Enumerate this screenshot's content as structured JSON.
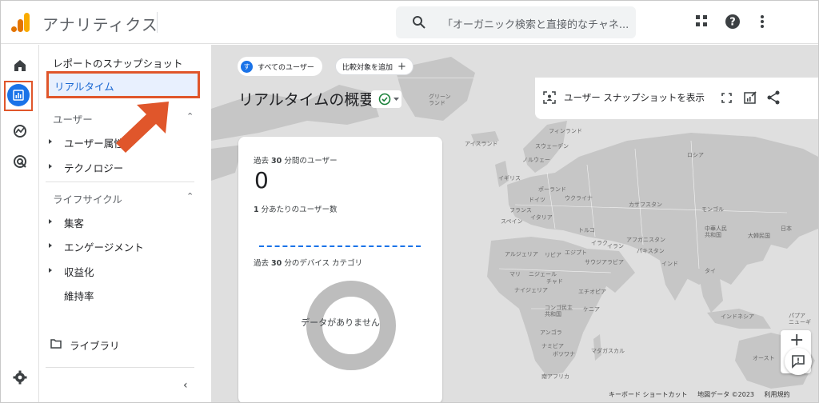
{
  "app": {
    "title": "アナリティクス",
    "logo_icon": "analytics-logo-icon"
  },
  "search": {
    "placeholder": "「オーガニック検索と直接的なチャネ..."
  },
  "topbar_icons": [
    "apps-grid-icon",
    "help-icon",
    "more-vert-icon"
  ],
  "rail": [
    "home-icon",
    "reports-icon",
    "explore-icon",
    "advertising-icon",
    "settings-icon"
  ],
  "nav": {
    "snapshot": "レポートのスナップショット",
    "realtime": "リアルタイム",
    "users_header": "ユーザー",
    "user_attributes": "ユーザー属性",
    "technology": "テクノロジー",
    "lifecycle_header": "ライフサイクル",
    "acquisition": "集客",
    "engagement": "エンゲージメント",
    "monetization": "収益化",
    "retention": "維持率",
    "library": "ライブラリ"
  },
  "header": {
    "segment_badge": "す",
    "segment": "すべてのユーザー",
    "add_compare": "比較対象を追加",
    "page_title": "リアルタイムの概要",
    "snapshot_button": "ユーザー スナップショットを表示"
  },
  "card": {
    "users_label_prefix": "過去",
    "users_label_num": "30",
    "users_label_suffix": "分間のユーザー",
    "users_value": "0",
    "per_min_num": "1",
    "per_min_suffix": "分あたりのユーザー数",
    "device_prefix": "過去",
    "device_num": "30",
    "device_suffix": "分のデバイス カテゴリ",
    "no_data": "データがありません"
  },
  "map_labels": {
    "greenland": "グリーン\nランド",
    "iceland": "アイスランド",
    "finland": "フィンランド",
    "sweden": "スウェーデン",
    "norway": "ノルウェー",
    "russia": "ロシア",
    "uk": "イギリス",
    "poland": "ポーランド",
    "germany": "ドイツ",
    "ukraine": "ウクライナ",
    "france": "フランス",
    "kazakhstan": "カザフスタン",
    "mongolia": "モンゴル",
    "italy": "イタリア",
    "spain": "スペイン",
    "turkey": "トルコ",
    "china": "中華人民\n共和国",
    "korea": "大韓民国",
    "japan": "日本",
    "afghanistan": "アフガニスタン",
    "iraq": "イラク",
    "iran": "イラン",
    "pakistan": "パキスタン",
    "algeria": "アルジェリア",
    "libya": "リビア",
    "egypt": "エジプト",
    "saudi": "サウジアラビア",
    "india": "インド",
    "thailand": "タイ",
    "mali": "マリ",
    "niger": "ニジェール",
    "chad": "チャド",
    "nigeria": "ナイジェリア",
    "ethiopia": "エチオピア",
    "drc": "コンゴ民主\n共和国",
    "kenya": "ケニア",
    "indonesia": "インドネシア",
    "png": "パプア\nニューギ",
    "angola": "アンゴラ",
    "namibia": "ナミビア",
    "botswana": "ボツワナ",
    "madagascar": "マダガスカル",
    "australia": "オースト",
    "south_africa": "南アフリカ"
  },
  "footer": {
    "shortcuts": "キーボード ショートカット",
    "map_data": "地図データ ©2023",
    "terms": "利用規約"
  },
  "colors": {
    "accent": "#1a73e8",
    "highlight": "#e0562b",
    "map": "#dfdfdf"
  }
}
